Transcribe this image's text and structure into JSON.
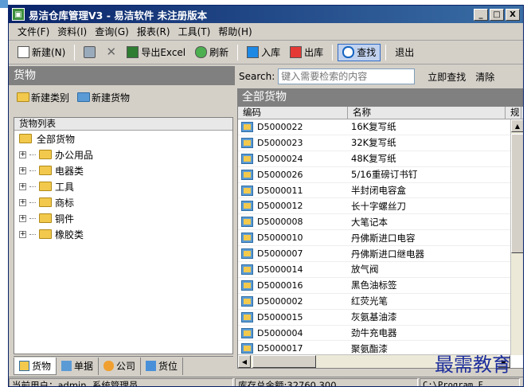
{
  "window": {
    "title": "易洁仓库管理V3 - 易洁软件 未注册版本",
    "minimize": "_",
    "maximize": "□",
    "close": "X"
  },
  "menu": [
    "文件(F)",
    "资料(I)",
    "查询(G)",
    "报表(R)",
    "工具(T)",
    "帮助(H)"
  ],
  "toolbar": {
    "new": "新建(N)",
    "export_excel": "导出Excel",
    "refresh": "刷新",
    "inbound": "入库",
    "outbound": "出库",
    "find": "查找",
    "exit": "退出"
  },
  "left": {
    "header": "货物",
    "new_category": "新建类别",
    "new_goods": "新建货物",
    "tree_header": "货物列表",
    "root": "全部货物",
    "categories": [
      "办公用品",
      "电器类",
      "工具",
      "商标",
      "铜件",
      "橡胶类"
    ],
    "tabs": [
      "货物",
      "单据",
      "公司",
      "货位"
    ]
  },
  "search": {
    "label": "Search:",
    "placeholder": "键入需要检索的内容",
    "go": "立即查找",
    "clear": "清除"
  },
  "list": {
    "header": "全部货物",
    "columns": [
      "编码",
      "名称",
      "规"
    ],
    "rows": [
      {
        "code": "D5000022",
        "name": "16K复写纸"
      },
      {
        "code": "D5000023",
        "name": "32K复写纸"
      },
      {
        "code": "D5000024",
        "name": "48K复写纸"
      },
      {
        "code": "D5000026",
        "name": "5/16重磅订书钉"
      },
      {
        "code": "D5000011",
        "name": "半封闭电容盒"
      },
      {
        "code": "D5000012",
        "name": "长十字螺丝刀"
      },
      {
        "code": "D5000008",
        "name": "大笔记本"
      },
      {
        "code": "D5000010",
        "name": "丹佛斯进口电容"
      },
      {
        "code": "D5000007",
        "name": "丹佛斯进口继电器"
      },
      {
        "code": "D5000014",
        "name": "放气阀"
      },
      {
        "code": "D5000016",
        "name": "黑色油标签"
      },
      {
        "code": "D5000002",
        "name": "红荧光笔"
      },
      {
        "code": "D5000015",
        "name": "灰氨基油漆"
      },
      {
        "code": "D5000004",
        "name": "劲牛充电器"
      },
      {
        "code": "D5000017",
        "name": "聚氨酯漆"
      }
    ]
  },
  "status": {
    "user": "当前用户：admin, 系统管理员",
    "total": "库存总金额:32760.300",
    "path": "C:\\Program F"
  },
  "watermark": "最需教育"
}
